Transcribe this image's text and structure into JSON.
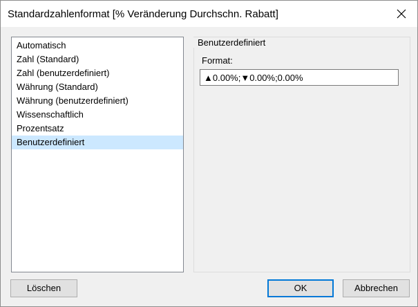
{
  "window": {
    "title": "Standardzahlenformat [% Veränderung Durchschn. Rabatt]",
    "close_icon": "close-icon"
  },
  "format_types": {
    "items": [
      {
        "label": "Automatisch",
        "selected": false
      },
      {
        "label": "Zahl (Standard)",
        "selected": false
      },
      {
        "label": "Zahl (benutzerdefiniert)",
        "selected": false
      },
      {
        "label": "Währung (Standard)",
        "selected": false
      },
      {
        "label": "Währung (benutzerdefiniert)",
        "selected": false
      },
      {
        "label": "Wissenschaftlich",
        "selected": false
      },
      {
        "label": "Prozentsatz",
        "selected": false
      },
      {
        "label": "Benutzerdefiniert",
        "selected": true
      }
    ]
  },
  "custom_panel": {
    "group_label": "Benutzerdefiniert",
    "format_label": "Format:",
    "format_value": "▲0.00%;▼0.00%;0.00%"
  },
  "buttons": {
    "clear": "Löschen",
    "ok": "OK",
    "cancel": "Abbrechen"
  },
  "colors": {
    "selection": "#cce8ff",
    "default_button_border": "#0078d7",
    "dialog_background": "#f0f0f0"
  }
}
